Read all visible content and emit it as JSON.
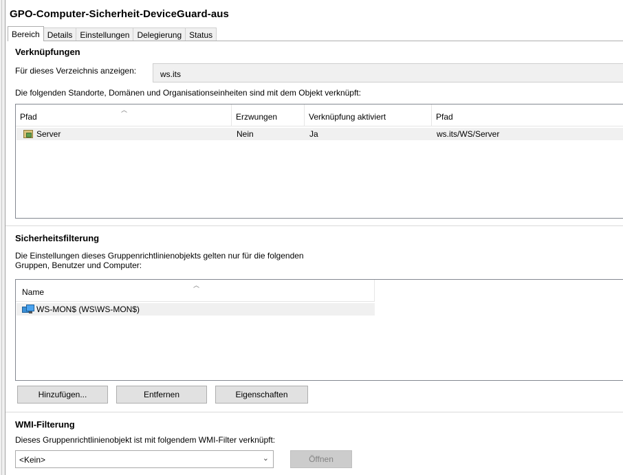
{
  "window": {
    "title": "GPO-Computer-Sicherheit-DeviceGuard-aus"
  },
  "tabs": [
    {
      "label": "Bereich",
      "active": true
    },
    {
      "label": "Details",
      "active": false
    },
    {
      "label": "Einstellungen",
      "active": false
    },
    {
      "label": "Delegierung",
      "active": false
    },
    {
      "label": "Status",
      "active": false
    }
  ],
  "links": {
    "heading": "Verknüpfungen",
    "directory_label": "Für dieses Verzeichnis anzeigen:",
    "directory_value": "ws.its",
    "description": "Die folgenden Standorte, Domänen und Organisationseinheiten sind mit dem Objekt verknüpft:",
    "columns": [
      "Pfad",
      "Erzwungen",
      "Verknüpfung aktiviert",
      "Pfad"
    ],
    "rows": [
      {
        "name": "Server",
        "enforced": "Nein",
        "enabled": "Ja",
        "path": "ws.its/WS/Server",
        "icon": "ou-folder-icon"
      }
    ]
  },
  "security": {
    "heading": "Sicherheitsfilterung",
    "description_line1": "Die Einstellungen dieses Gruppenrichtlinienobjekts gelten nur für die folgenden",
    "description_line2": "Gruppen, Benutzer und Computer:",
    "columns": [
      "Name"
    ],
    "rows": [
      {
        "name": "WS-MON$ (WS\\WS-MON$)",
        "icon": "computer-icon"
      }
    ],
    "buttons": {
      "add": "Hinzufügen...",
      "remove": "Entfernen",
      "properties": "Eigenschaften"
    }
  },
  "wmi": {
    "heading": "WMI-Filterung",
    "description": "Dieses Gruppenrichtlinienobjekt ist mit folgendem WMI-Filter verknüpft:",
    "selected": "<Kein>",
    "open_button": "Öffnen"
  },
  "colors": {
    "selection_bg": "#f0f0f0",
    "button_bg": "#e1e1e1",
    "disabled_text": "#838383"
  }
}
